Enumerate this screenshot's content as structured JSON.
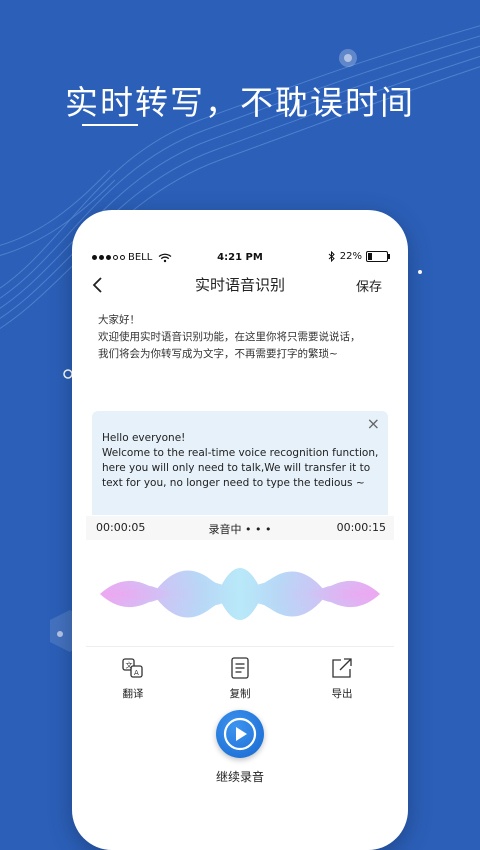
{
  "headline": "实时转写，不耽误时间",
  "statusbar": {
    "carrier": "BELL",
    "time": "4:21 PM",
    "battery": "22%"
  },
  "nav": {
    "title": "实时语音识别",
    "save_label": "保存"
  },
  "transcript": [
    "大家好！",
    "欢迎使用实时语音识别功能，在这里你将只需要说说话，",
    "我们将会为你转写成为文字，不再需要打字的繁琐~"
  ],
  "translation": {
    "lines": [
      "Hello everyone!",
      "Welcome to the real-time voice recognition function,",
      "here you will only need to talk,We will transfer it to",
      "text for you, no longer need to type the tedious ~"
    ],
    "close_symbol": "×"
  },
  "recording": {
    "elapsed": "00:00:05",
    "status": "录音中 • • •",
    "total": "00:00:15"
  },
  "actions": [
    {
      "label": "翻译",
      "icon": "translate-icon"
    },
    {
      "label": "复制",
      "icon": "copy-icon"
    },
    {
      "label": "导出",
      "icon": "export-icon"
    }
  ],
  "continue_label": "继续录音",
  "colors": {
    "background": "#2b5fb8",
    "accent": "#1767cf",
    "translation_bg": "#e6f1fa"
  }
}
